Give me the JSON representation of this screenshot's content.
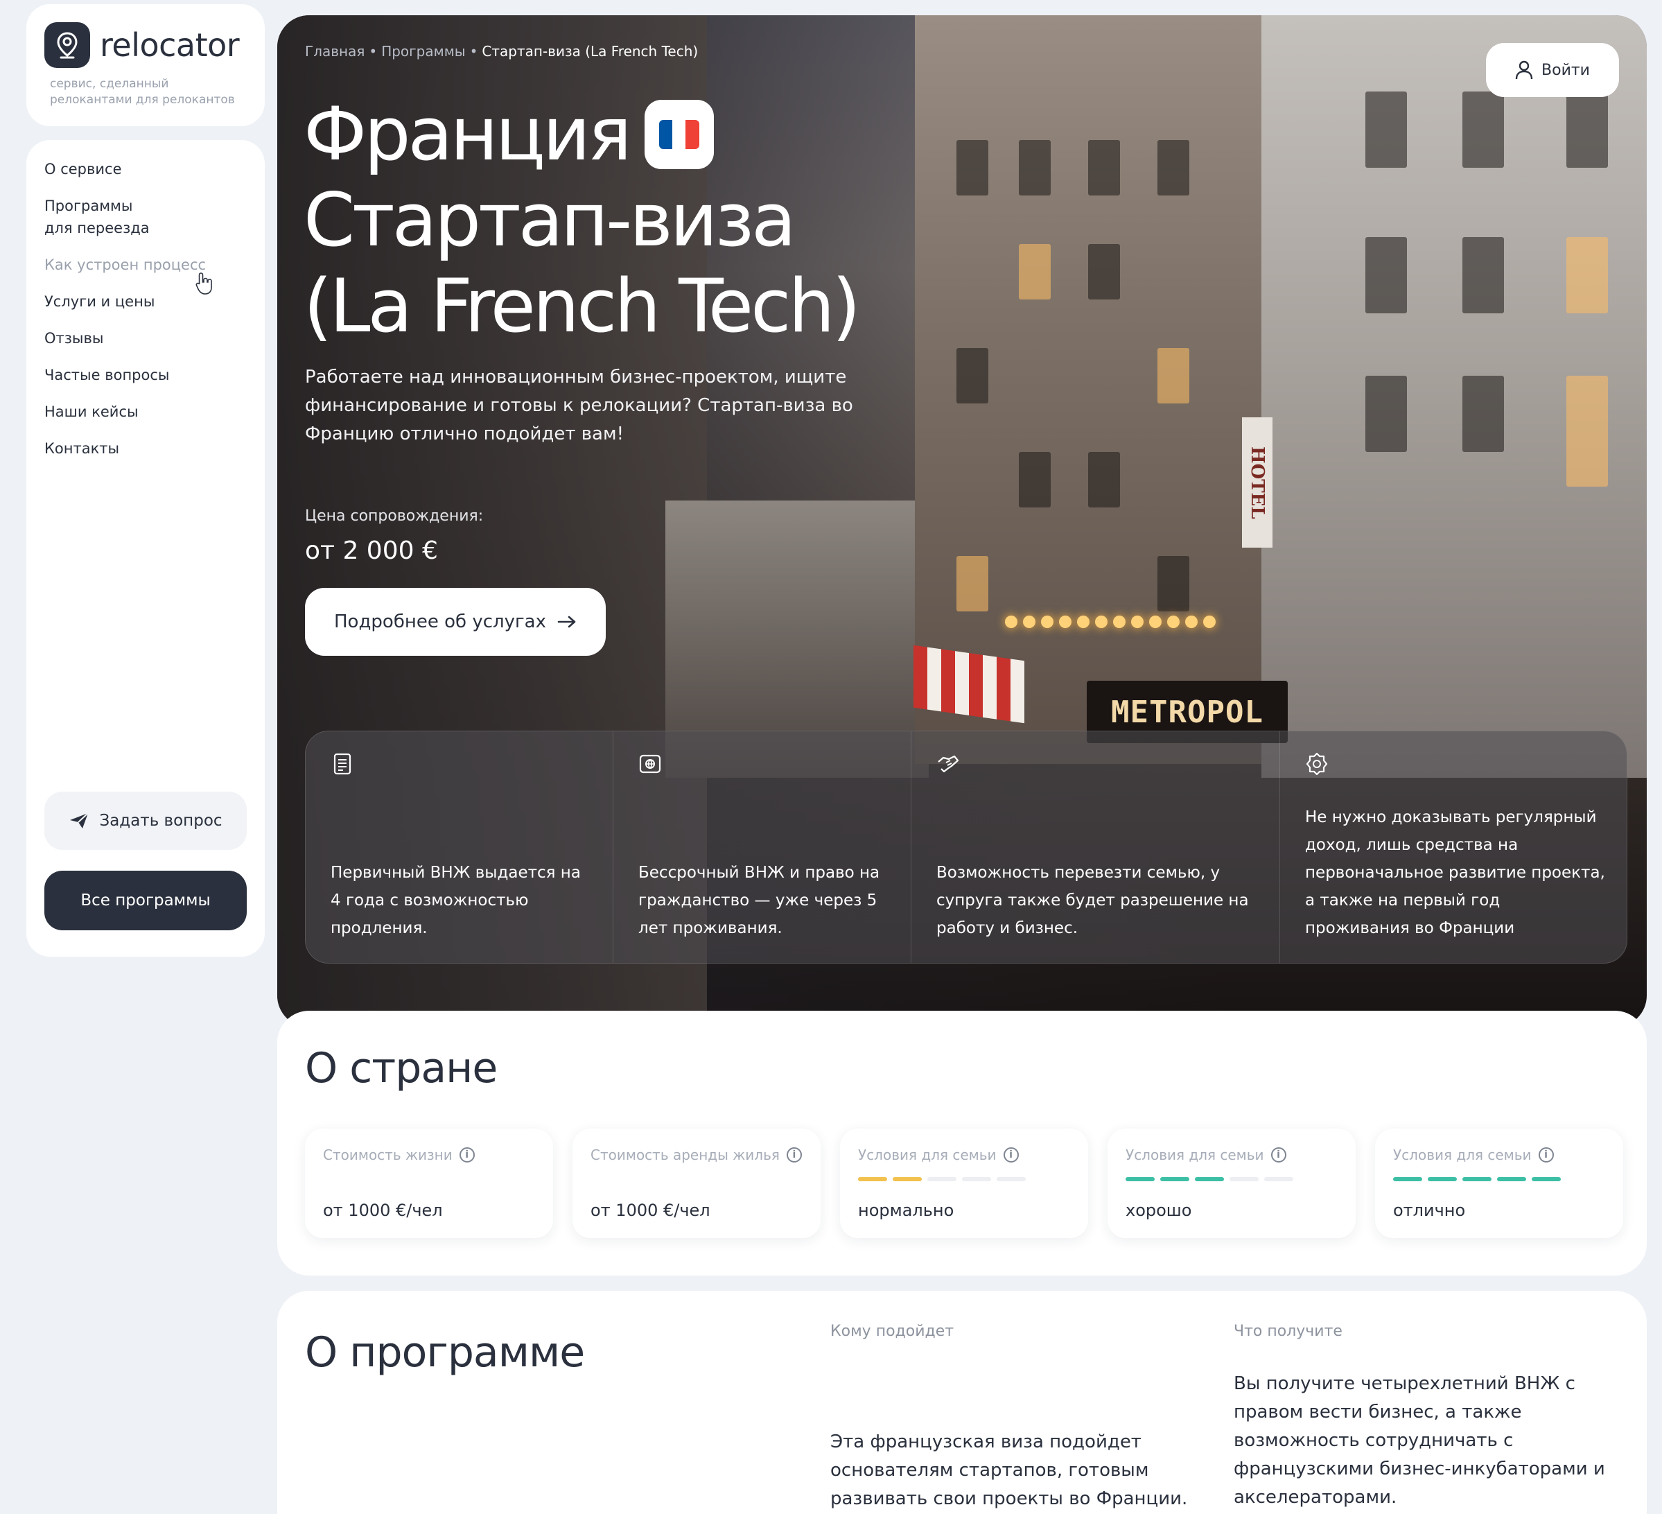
{
  "brand": {
    "name": "relocator",
    "tagline": "сервис, сделанный релокантами для релокантов"
  },
  "sidebar": {
    "items": [
      {
        "label": "О сервисе"
      },
      {
        "label": "Программы для переезда"
      },
      {
        "label": "Как устроен процесс"
      },
      {
        "label": "Услуги и цены"
      },
      {
        "label": "Отзывы"
      },
      {
        "label": "Частые вопросы"
      },
      {
        "label": "Наши кейсы"
      },
      {
        "label": "Контакты"
      }
    ],
    "ask_label": "Задать вопрос",
    "all_programs_label": "Все программы"
  },
  "breadcrumb": {
    "home": "Главная",
    "programs": "Программы",
    "current": "Стартап-виза (La French Tech)"
  },
  "header": {
    "login_label": "Войти"
  },
  "hero": {
    "title_line1": "Франция",
    "title_line2": "Стартап-виза",
    "title_line3": "(La French Tech)",
    "description": "Работаете над инновационным бизнес-проектом, ищите финансирование и готовы к релокации? Стартап-виза во Францию отлично подойдет вам!",
    "price_label": "Цена сопровождения:",
    "price_value": "от 2 000 €",
    "more_label": "Подробнее об услугах",
    "photo_text": {
      "sign": "METROPOL",
      "hotel": "HOTEL"
    },
    "flag_colors": [
      "#0055a4",
      "#ffffff",
      "#ef4135"
    ]
  },
  "features": [
    {
      "icon": "document-icon",
      "text": "Первичный ВНЖ выдается на 4 года с возможностью продления."
    },
    {
      "icon": "passport-icon",
      "text": "Бессрочный ВНЖ и право на гражданство — уже через 5 лет проживания."
    },
    {
      "icon": "handshake-icon",
      "text": "Возможность перевезти семью, у супруга также будет разрешение на работу и бизнес."
    },
    {
      "icon": "badge-icon",
      "text": "Не нужно доказывать регулярный доход, лишь средства на первоначальное развитие проекта, а также на первый год проживания во Франции"
    }
  ],
  "country": {
    "title": "О стране",
    "stats": [
      {
        "label": "Стоимость жизни",
        "value": "от 1000 €/чел",
        "level": null
      },
      {
        "label": "Стоимость аренды жилья",
        "value": "от 1000 €/чел",
        "level": null
      },
      {
        "label": "Условия для семьи",
        "value": "нормально",
        "level": 2,
        "level_max": 5,
        "color": "#f2c14e"
      },
      {
        "label": "Условия для семьи",
        "value": "хорошо",
        "level": 3,
        "level_max": 5,
        "color": "#3cbfa4"
      },
      {
        "label": "Условия для семьи",
        "value": "отлично",
        "level": 5,
        "level_max": 5,
        "color": "#3cbfa4"
      }
    ]
  },
  "program": {
    "title": "О программе",
    "who_head": "Кому подойдет",
    "who_text": "Эта французская виза подойдет основателям стартапов, готовым развивать свои проекты во Франции.",
    "what_head": "Что получите",
    "what_text": "Вы получите четырехлетний ВНЖ с правом вести бизнес, а также возможность сотрудничать с французскими бизнес-инкубаторами и акселераторами."
  }
}
